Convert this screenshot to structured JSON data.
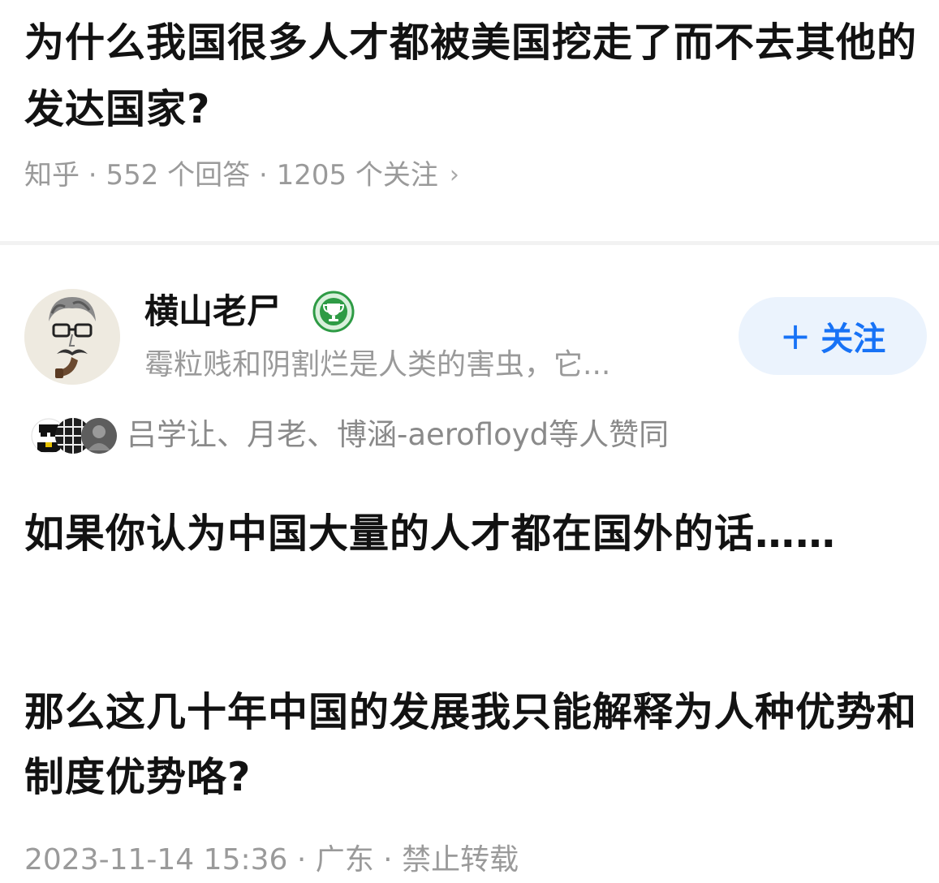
{
  "question": {
    "title": "为什么我国很多人才都被美国挖走了而不去其他的发达国家?",
    "source": "知乎",
    "separator": " · ",
    "answers_count": "552 个回答",
    "followers_count": "1205 个关注",
    "arrow_icon": "chevron-right-icon"
  },
  "author": {
    "name": "横山老尸",
    "badge_icon": "trophy-badge-icon",
    "badge_color": "#2e9b45",
    "bio": "霉粒贱和阴割烂是人类的害虫，它...",
    "follow_label": "关注",
    "follow_color": "#1772f6"
  },
  "voters": {
    "text": "吕学让、月老、博涵-aerofloyd等人赞同"
  },
  "answer": {
    "paragraphs": [
      "如果你认为中国大量的人才都在国外的话……",
      "那么这几十年中国的发展我只能解释为人种优势和制度优势咯?"
    ],
    "meta": "2023-11-14 15:36 · 广东 · 禁止转载"
  }
}
